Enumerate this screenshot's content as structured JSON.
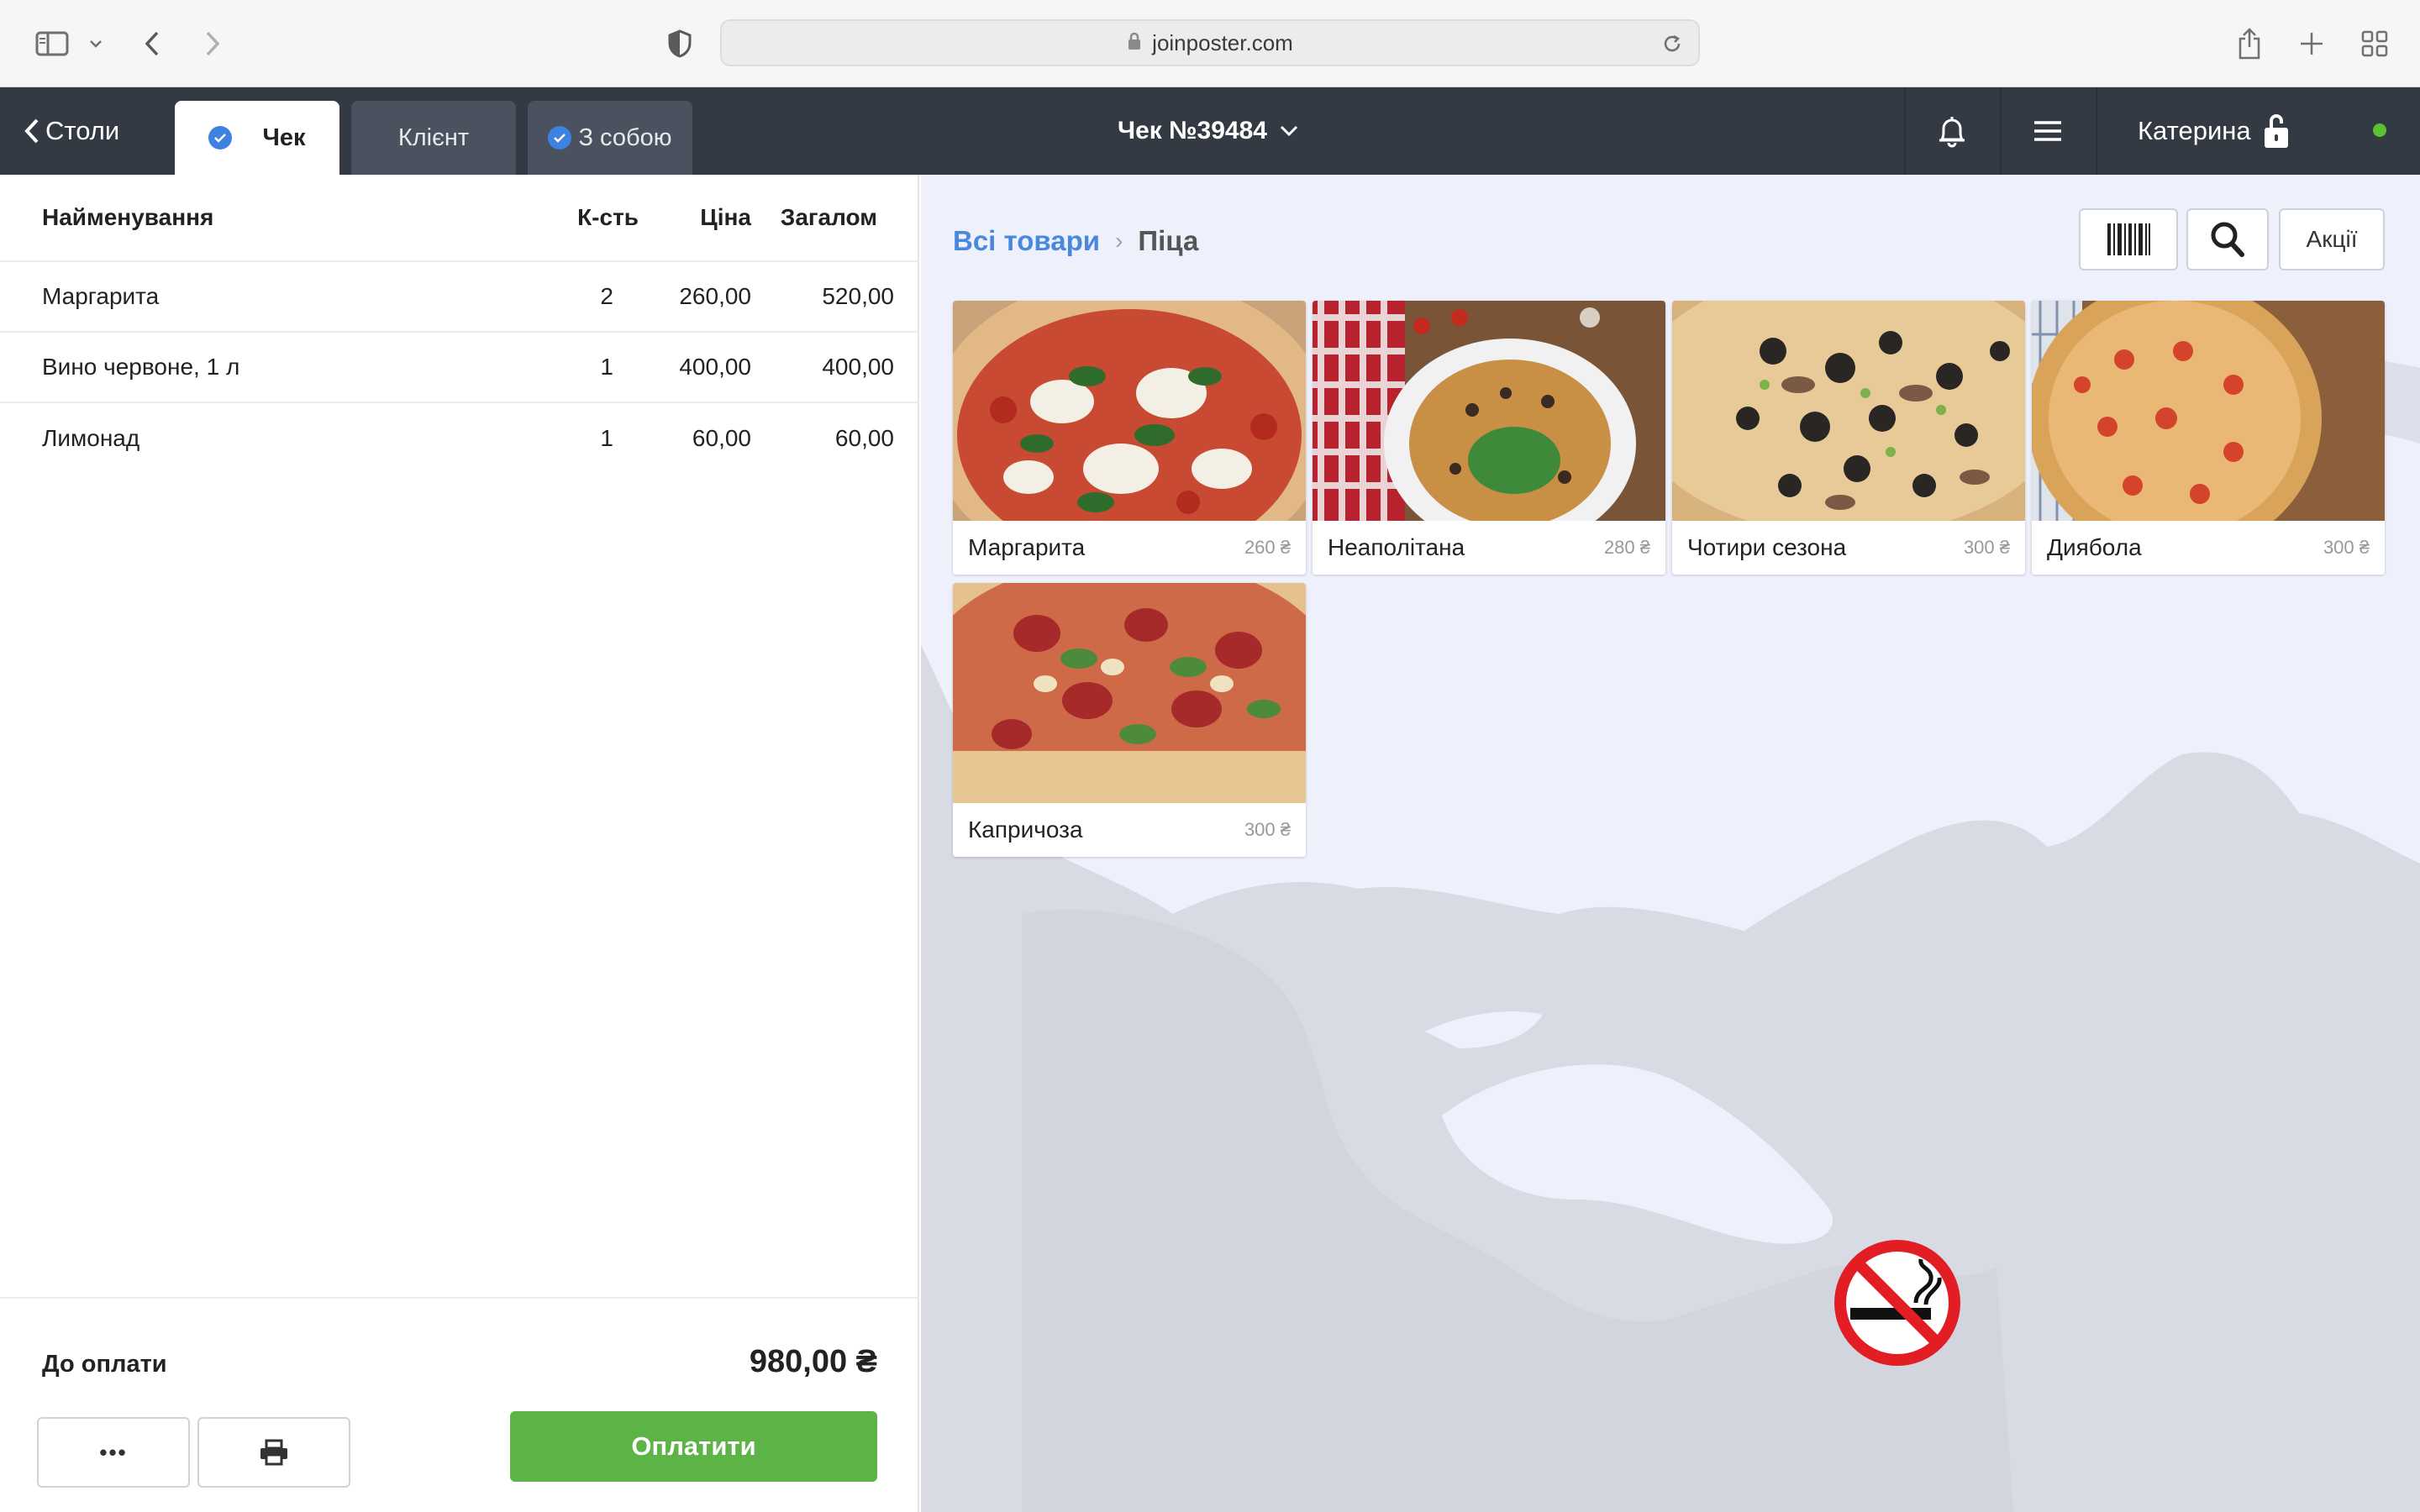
{
  "browser": {
    "url": "joinposter.com",
    "icons": [
      "sidebar-icon",
      "chevron-down-icon",
      "back-icon",
      "forward-icon",
      "shield-icon",
      "lock-icon",
      "reload-icon",
      "share-icon",
      "new-tab-icon",
      "tab-overview-icon"
    ]
  },
  "header": {
    "back_label": "Столи",
    "tabs": [
      {
        "label": "Чек",
        "checked": true,
        "active": true
      },
      {
        "label": "Клієнт",
        "checked": false,
        "active": false
      },
      {
        "label": "З собою",
        "checked": true,
        "active": false
      }
    ],
    "receipt_title": "Чек №39484",
    "user_name": "Катерина",
    "status_color": "#5bc236",
    "icons": [
      "bell-icon",
      "menu-icon",
      "unlock-icon"
    ]
  },
  "order": {
    "columns": {
      "name": "Найменування",
      "qty": "К-сть",
      "price": "Ціна",
      "total": "Загалом"
    },
    "rows": [
      {
        "name": "Маргарита",
        "qty": "2",
        "price": "260,00",
        "total": "520,00"
      },
      {
        "name": "Вино червоне, 1 л",
        "qty": "1",
        "price": "400,00",
        "total": "400,00"
      },
      {
        "name": "Лимонад",
        "qty": "1",
        "price": "60,00",
        "total": "60,00"
      }
    ],
    "due_label": "До оплати",
    "due_amount": "980,00 ₴",
    "more_label": "•••",
    "pay_label": "Оплатити"
  },
  "catalog": {
    "breadcrumb_root": "Всі товари",
    "breadcrumb_current": "Піца",
    "promo_label": "Акції",
    "products": [
      {
        "name": "Маргарита",
        "price": "260 ₴"
      },
      {
        "name": "Неаполітана",
        "price": "280 ₴"
      },
      {
        "name": "Чотири сезона",
        "price": "300 ₴"
      },
      {
        "name": "Диябола",
        "price": "300 ₴"
      },
      {
        "name": "Капричоза",
        "price": "300 ₴"
      }
    ]
  },
  "colors": {
    "header_bg": "#343a43",
    "accent_blue": "#4a88de",
    "pay_green": "#5cb447",
    "catalog_bg": "#eef0fb"
  }
}
